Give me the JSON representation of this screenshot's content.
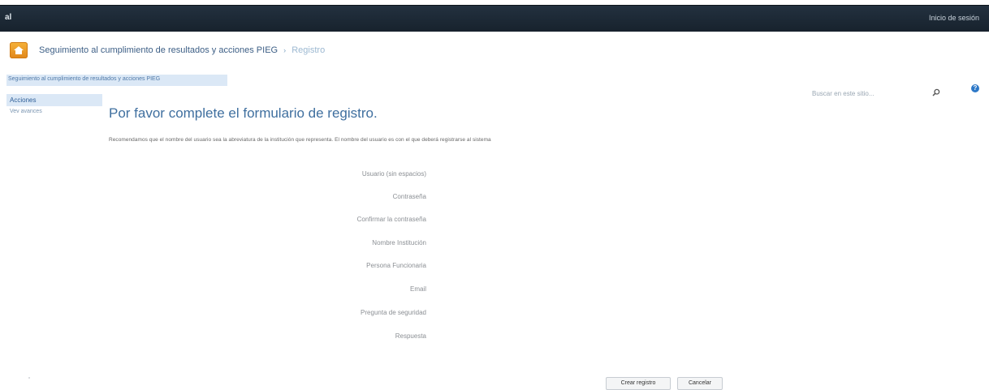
{
  "topbar": {
    "brand": "al",
    "signin": "Inicio de sesión"
  },
  "site": {
    "title": "Seguimiento al cumplimiento de resultados y acciones PIEG",
    "separator": "›",
    "current_page": "Registro"
  },
  "breadcrumb": "Seguimiento al cumplimiento de resultados y acciones PIEG",
  "search": {
    "placeholder": "Buscar en este sitio..."
  },
  "leftnav": {
    "items": [
      "Acciones",
      "Vev avances"
    ]
  },
  "form": {
    "title": "Por favor complete el formulario de registro.",
    "note": "Recomendamos que el nombre del usuario sea la abreviatura de la institución que representa. El nombre del usuario es con el que deberá registrarse al sistema",
    "fields": [
      "Usuario (sin espacios)",
      "Contraseña",
      "Confirmar la contraseña",
      "Nombre Institución",
      "Persona Funcionaria",
      "Email",
      "Pregunta de seguridad",
      "Respuesta"
    ],
    "buttons": {
      "create": "Crear registro",
      "cancel": "Cancelar"
    }
  },
  "colors": {
    "topbar": "#1d2a36",
    "accent": "#3f6f9f",
    "highlight": "#dbe8f6",
    "icon": "#f0a02e"
  }
}
